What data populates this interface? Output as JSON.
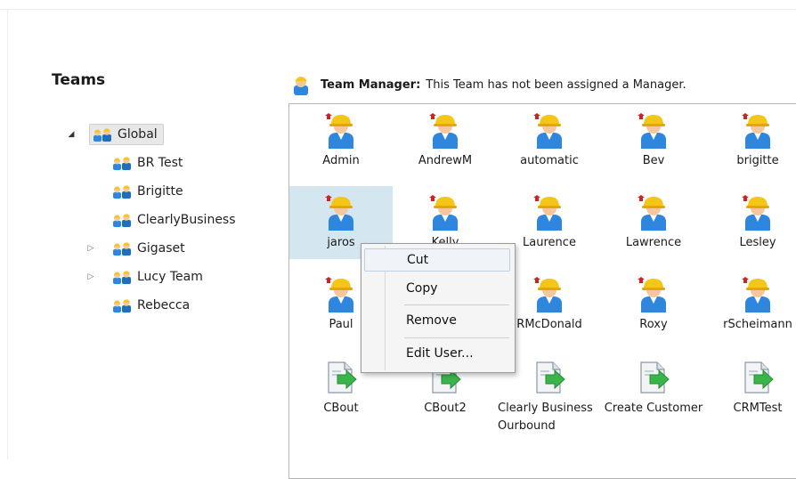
{
  "teams_panel": {
    "title": "Teams",
    "tree": [
      {
        "label": "Global",
        "expander": "open",
        "selected": true
      },
      {
        "label": "BR Test",
        "expander": "none"
      },
      {
        "label": "Brigitte",
        "expander": "none"
      },
      {
        "label": "ClearlyBusiness",
        "expander": "none"
      },
      {
        "label": "Gigaset",
        "expander": "closed"
      },
      {
        "label": "Lucy Team",
        "expander": "closed"
      },
      {
        "label": "Rebecca",
        "expander": "none"
      }
    ]
  },
  "manager_bar": {
    "label": "Team Manager:",
    "text": "This Team has not been assigned a Manager."
  },
  "members": [
    {
      "label": "Admin",
      "icon": "admin-user-icon"
    },
    {
      "label": "AndrewM",
      "icon": "admin-user-icon"
    },
    {
      "label": "automatic",
      "icon": "admin-user-icon"
    },
    {
      "label": "Bev",
      "icon": "admin-user-icon"
    },
    {
      "label": "brigitte",
      "icon": "admin-user-icon"
    },
    {
      "label": "jaros",
      "icon": "admin-user-icon",
      "selected": true
    },
    {
      "label": "Kelly",
      "icon": "admin-user-icon"
    },
    {
      "label": "Laurence",
      "icon": "admin-user-icon"
    },
    {
      "label": "Lawrence",
      "icon": "admin-user-icon"
    },
    {
      "label": "Lesley",
      "icon": "admin-user-icon"
    },
    {
      "label": "Paul",
      "icon": "admin-user-icon"
    },
    {
      "label": "",
      "icon": "admin-user-icon"
    },
    {
      "label": "RMcDonald",
      "icon": "admin-user-icon"
    },
    {
      "label": "Roxy",
      "icon": "admin-user-icon"
    },
    {
      "label": "rScheimann",
      "icon": "admin-user-icon"
    },
    {
      "label": "CBout",
      "icon": "script-document-icon"
    },
    {
      "label": "CBout2",
      "icon": "script-document-icon"
    },
    {
      "label": "Clearly Business Ourbound",
      "icon": "script-document-icon"
    },
    {
      "label": "Create Customer",
      "icon": "script-document-icon"
    },
    {
      "label": "CRMTest",
      "icon": "script-document-icon"
    }
  ],
  "context_menu": {
    "items": [
      "Cut",
      "Copy",
      "Remove",
      "Edit User..."
    ]
  },
  "colors": {
    "selection": "#d4e6f0",
    "helmet": "#f5c518",
    "body": "#2e86de",
    "arrow": "#3ab54a"
  }
}
